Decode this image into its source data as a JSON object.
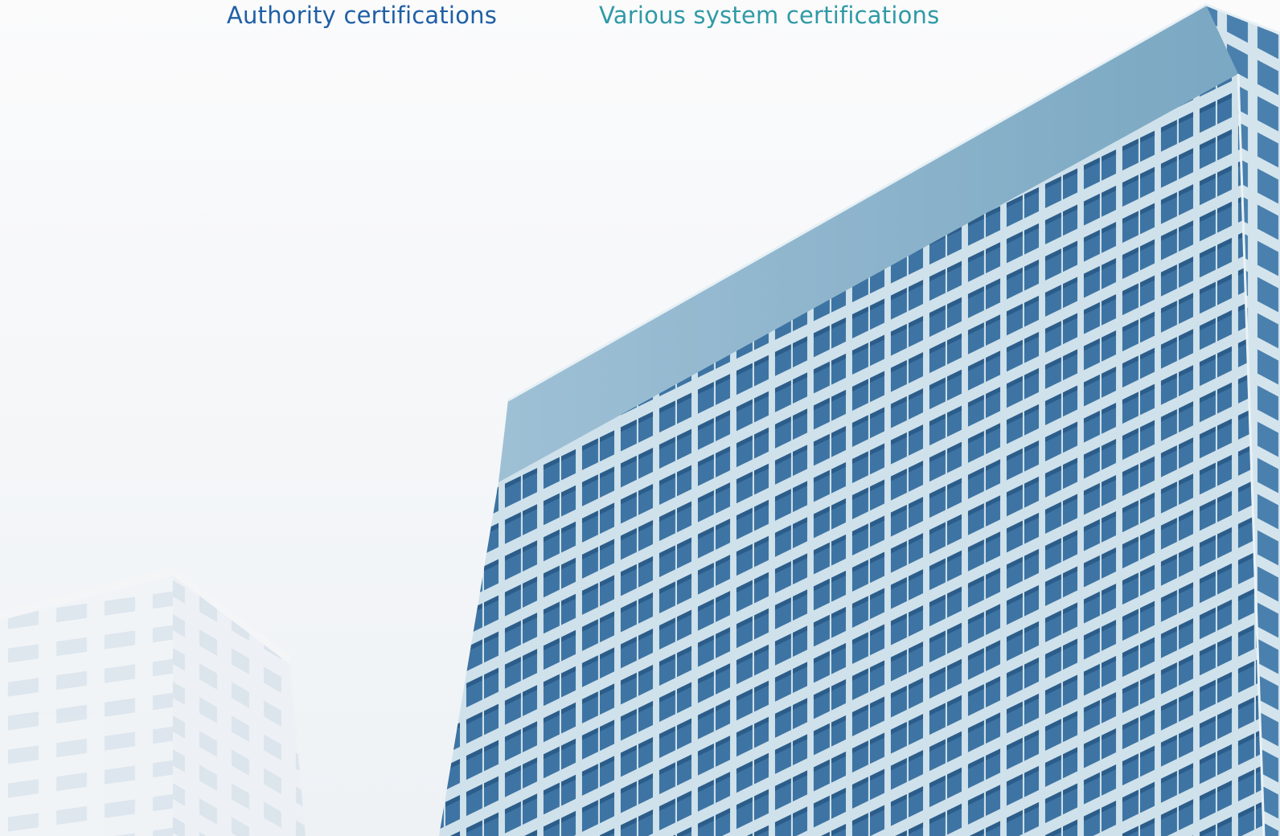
{
  "tabs": [
    {
      "label": "Authority certifications",
      "color": "#1f5fa6"
    },
    {
      "label": "Various system certifications",
      "color": "#2f9aa6"
    }
  ],
  "hero_image": {
    "icon": "building-photo",
    "colors": {
      "sky": "#f6f7f8",
      "glass": "#3f78a8",
      "frame": "#d6e6ee",
      "roof": "#86aec6",
      "ghost_building": "#e8edf2"
    }
  }
}
